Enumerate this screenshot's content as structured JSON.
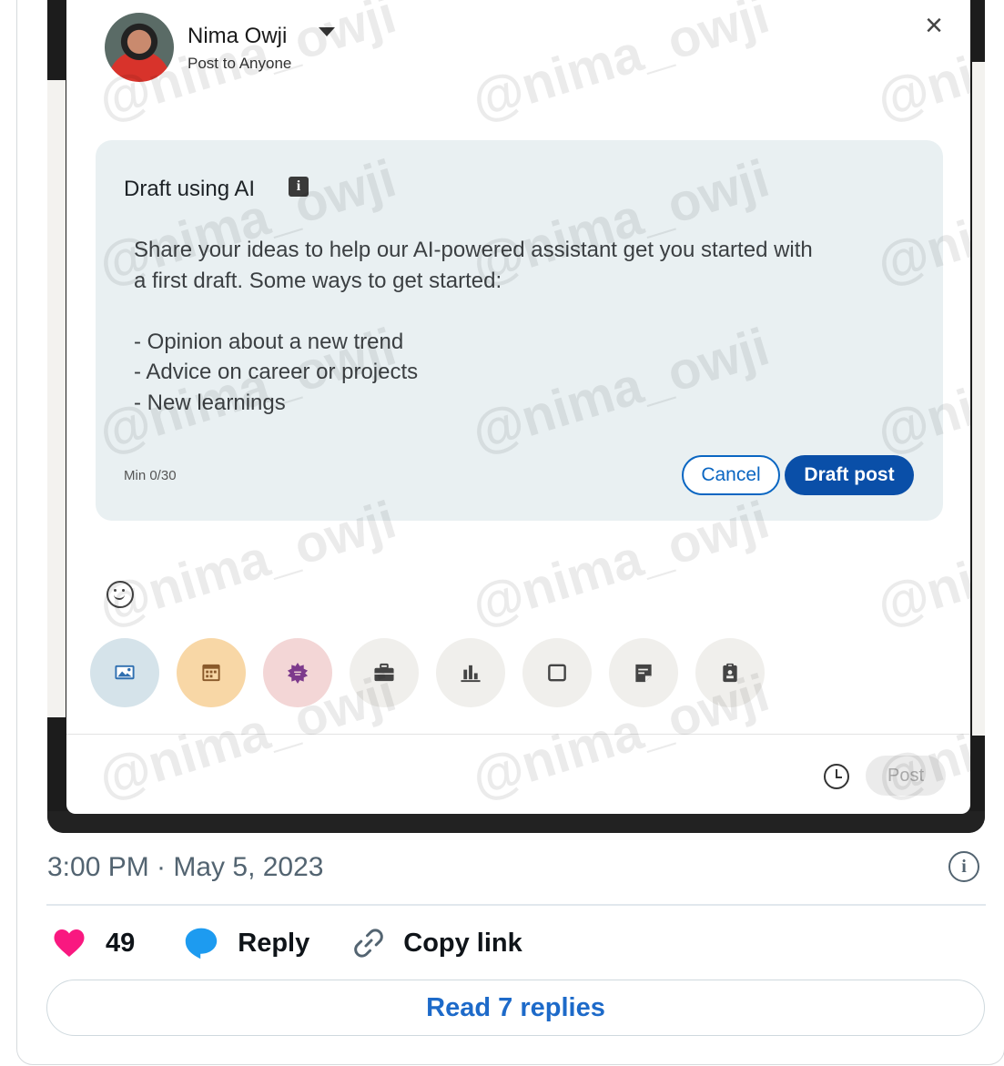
{
  "composer": {
    "author_name": "Nima Owji",
    "visibility": "Post to Anyone",
    "ai_draft": {
      "title": "Draft using AI",
      "info_glyph": "i",
      "prompt_text": "Share your ideas to help our AI-powered assistant get you started with\na first draft. Some ways to get started:\n\n- Opinion about a new trend\n- Advice on career or projects\n- New learnings",
      "char_counter": "Min 0/30",
      "cancel_label": "Cancel",
      "draft_label": "Draft post"
    },
    "toolbar": [
      {
        "icon": "image-icon",
        "bg": "#d5e3ea",
        "color": "#2f6fb0"
      },
      {
        "icon": "calendar-event-icon",
        "bg": "#f8d7a6",
        "color": "#8a5a2b"
      },
      {
        "icon": "celebrate-badge-icon",
        "bg": "#f3d6d6",
        "color": "#7d3a8c"
      },
      {
        "icon": "briefcase-icon",
        "bg": "#f0efec",
        "color": "#444444"
      },
      {
        "icon": "poll-chart-icon",
        "bg": "#f0efec",
        "color": "#444444"
      },
      {
        "icon": "document-icon",
        "bg": "#f0efec",
        "color": "#444444"
      },
      {
        "icon": "note-icon",
        "bg": "#f0efec",
        "color": "#444444"
      },
      {
        "icon": "clipboard-icon",
        "bg": "#f0efec",
        "color": "#444444"
      }
    ],
    "post_label": "Post"
  },
  "watermark": "@nima_owji",
  "tweet": {
    "timestamp": "3:00 PM · May 5, 2023",
    "like_count": "49",
    "reply_label": "Reply",
    "copy_link_label": "Copy link",
    "read_replies_label": "Read 7 replies"
  },
  "colors": {
    "linkedin_blue": "#0a66c2",
    "twitter_blue": "#1d9bf0",
    "like_pink": "#f91880"
  }
}
